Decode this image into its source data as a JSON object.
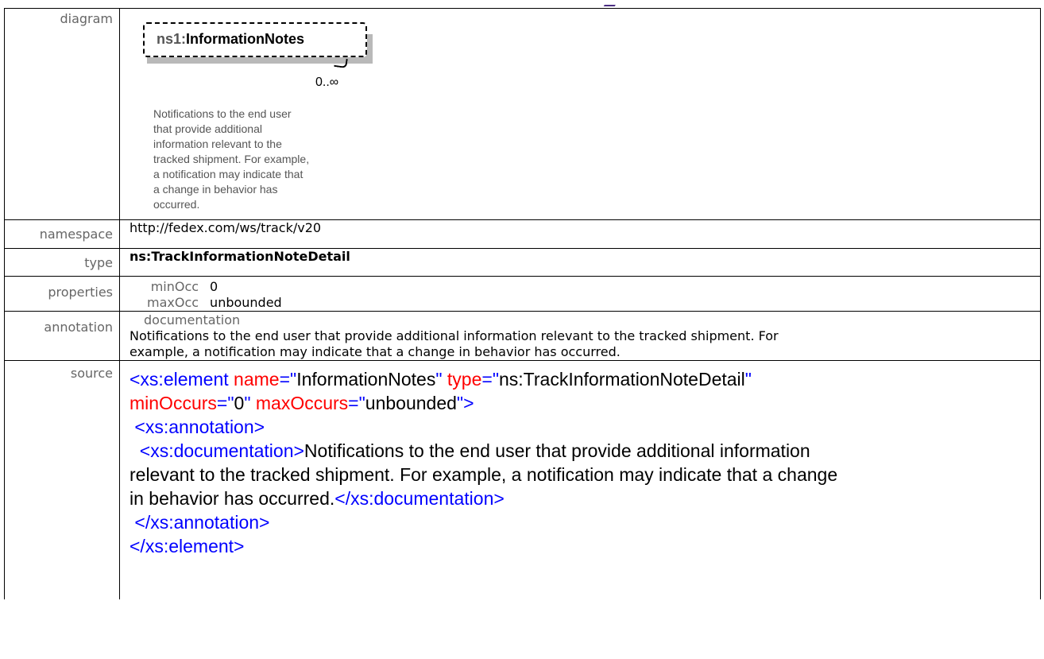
{
  "labels": {
    "diagram": "diagram",
    "namespace": "namespace",
    "type": "type",
    "properties": "properties",
    "annotation": "annotation",
    "source": "source"
  },
  "diagram": {
    "element_prefix": "ns1:",
    "element_name": "InformationNotes",
    "occurrence": "0..∞",
    "doc_lines": [
      "Notifications to the end user",
      "that provide additional",
      "information relevant to the",
      "tracked shipment. For example,",
      "a notification may indicate that",
      "a change in behavior has",
      "occurred."
    ]
  },
  "namespace": "http://fedex.com/ws/track/v20",
  "type": "ns:TrackInformationNoteDetail",
  "properties": {
    "minOcc_label": "minOcc",
    "minOcc_value": "0",
    "maxOcc_label": "maxOcc",
    "maxOcc_value": "unbounded"
  },
  "annotation": {
    "heading": "documentation",
    "lines": [
      "Notifications to the end user that provide additional information relevant to the tracked shipment. For",
      "example, a notification may indicate that a change in behavior has occurred."
    ]
  },
  "source": {
    "l1_open": "<xs:element ",
    "l1_attr1": "name",
    "l1_eq1": "=\"",
    "l1_val1": "InformationNotes",
    "l1_q1": "\" ",
    "l1_attr2": "type",
    "l1_eq2": "=\"",
    "l1_val2": "ns:TrackInformationNoteDetail",
    "l1_q2": "\"",
    "l2_attr1": "minOccurs",
    "l2_eq1": "=\"",
    "l2_val1": "0",
    "l2_q1": "\" ",
    "l2_attr2": "maxOccurs",
    "l2_eq2": "=\"",
    "l2_val2": "unbounded",
    "l2_close": "\">",
    "l3": " <xs:annotation>",
    "l4_tag": "  <xs:documentation>",
    "l4_text": "Notifications to the end user that provide additional information",
    "l5_text": "relevant to the tracked shipment. For example, a notification may indicate that a change",
    "l6_text": "in behavior has occurred.",
    "l6_tag": "</xs:documentation>",
    "l7": " </xs:annotation>",
    "l8": "</xs:element>"
  }
}
